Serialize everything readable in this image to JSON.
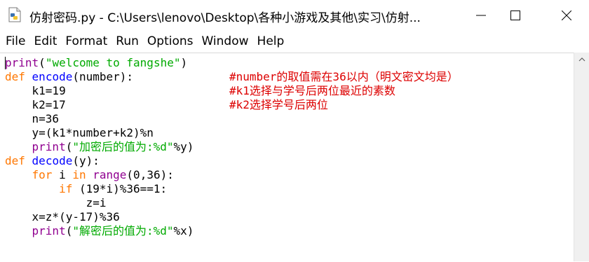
{
  "window": {
    "title": "仿射密码.py - C:\\Users\\lenovo\\Desktop\\各种小游戏及其他\\实习\\仿射..."
  },
  "menu": [
    "File",
    "Edit",
    "Format",
    "Run",
    "Options",
    "Window",
    "Help"
  ],
  "colors": {
    "keyword": "#ff7700",
    "builtin": "#900090",
    "string": "#00aa00",
    "definition": "#0000ff",
    "comment": "#dd0000"
  },
  "code": {
    "lines": [
      [
        {
          "t": "print",
          "c": "bi"
        },
        {
          "t": "(",
          "c": ""
        },
        {
          "t": "\"welcome to fangshe\"",
          "c": "str"
        },
        {
          "t": ")",
          "c": ""
        }
      ],
      [
        {
          "t": "def",
          "c": "kw"
        },
        {
          "t": " ",
          "c": ""
        },
        {
          "t": "encode",
          "c": "def"
        },
        {
          "t": "(number):",
          "c": ""
        }
      ],
      [
        {
          "t": "    k1=19",
          "c": ""
        }
      ],
      [
        {
          "t": "    k2=17",
          "c": ""
        }
      ],
      [
        {
          "t": "    n=36",
          "c": ""
        }
      ],
      [
        {
          "t": "    y=(k1*number+k2)%n",
          "c": ""
        }
      ],
      [
        {
          "t": "    ",
          "c": ""
        },
        {
          "t": "print",
          "c": "bi"
        },
        {
          "t": "(",
          "c": ""
        },
        {
          "t": "\"加密后的值为:%d\"",
          "c": "str"
        },
        {
          "t": "%y)",
          "c": ""
        }
      ],
      [
        {
          "t": "def",
          "c": "kw"
        },
        {
          "t": " ",
          "c": ""
        },
        {
          "t": "decode",
          "c": "def"
        },
        {
          "t": "(y):",
          "c": ""
        }
      ],
      [
        {
          "t": "    ",
          "c": ""
        },
        {
          "t": "for",
          "c": "kw"
        },
        {
          "t": " i ",
          "c": ""
        },
        {
          "t": "in",
          "c": "kw"
        },
        {
          "t": " ",
          "c": ""
        },
        {
          "t": "range",
          "c": "bi"
        },
        {
          "t": "(0,36):",
          "c": ""
        }
      ],
      [
        {
          "t": "        ",
          "c": ""
        },
        {
          "t": "if",
          "c": "kw"
        },
        {
          "t": " (19*i)%36==1:",
          "c": ""
        }
      ],
      [
        {
          "t": "            z=i",
          "c": ""
        }
      ],
      [
        {
          "t": "    x=z*(y-17)%36",
          "c": ""
        }
      ],
      [
        {
          "t": "    ",
          "c": ""
        },
        {
          "t": "print",
          "c": "bi"
        },
        {
          "t": "(",
          "c": ""
        },
        {
          "t": "\"解密后的值为:%d\"",
          "c": "str"
        },
        {
          "t": "%x)",
          "c": ""
        }
      ]
    ],
    "comments": [
      {
        "line": 1,
        "text": "#number的取值需在36以内（明文密文均是）"
      },
      {
        "line": 2,
        "text": "#k1选择与学号后两位最近的素数"
      },
      {
        "line": 3,
        "text": "#k2选择学号后两位"
      }
    ]
  }
}
